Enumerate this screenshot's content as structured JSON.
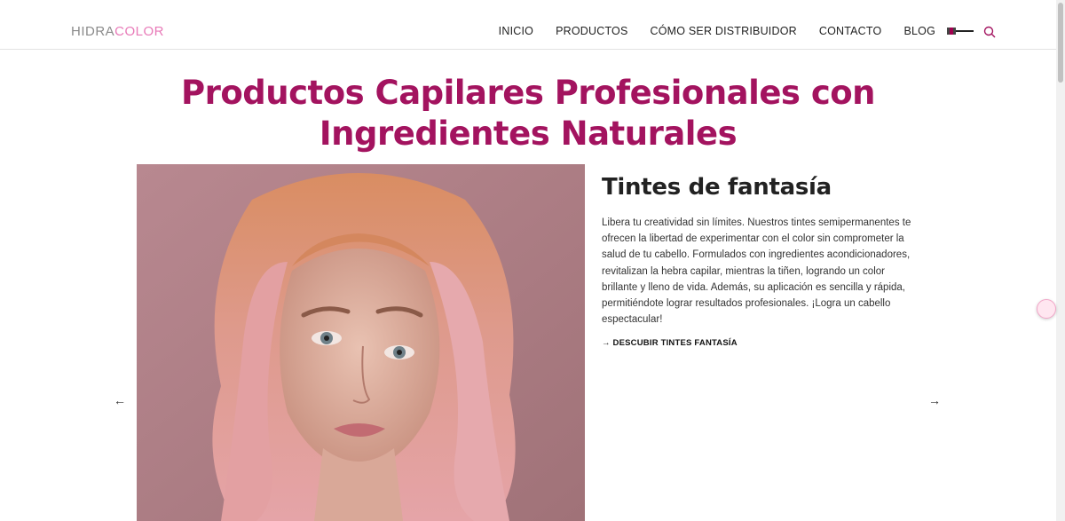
{
  "header": {
    "logo_part1": "HIDRA",
    "logo_part2": "COLOR",
    "nav": [
      "INICIO",
      "PRODUCTOS",
      "CÓMO SER DISTRIBUIDOR",
      "CONTACTO",
      "BLOG"
    ],
    "brand_color": "#a3135f",
    "logo_accent": "#e87ab8"
  },
  "hero": {
    "headline_line1": "Productos Capilares Profesionales con",
    "headline_line2": "Ingredientes Naturales"
  },
  "slide": {
    "title": "Tintes de fantasía",
    "text": "Libera tu creatividad sin límites. Nuestros tintes semipermanentes te ofrecen la libertad de experimentar con el color sin comprometer la salud de tu cabello. Formulados con ingredientes acondicionadores, revitalizan la hebra capilar, mientras la tiñen, logrando un color brillante y lleno de vida. Además, su aplicación es sencilla y rápida, permitiéndote lograr resultados profesionales. ¡Logra un cabello espectacular!",
    "link_label": "→ DESCUBIR TINTES FANTASÍA",
    "prev_arrow": "←",
    "next_arrow": "→"
  }
}
